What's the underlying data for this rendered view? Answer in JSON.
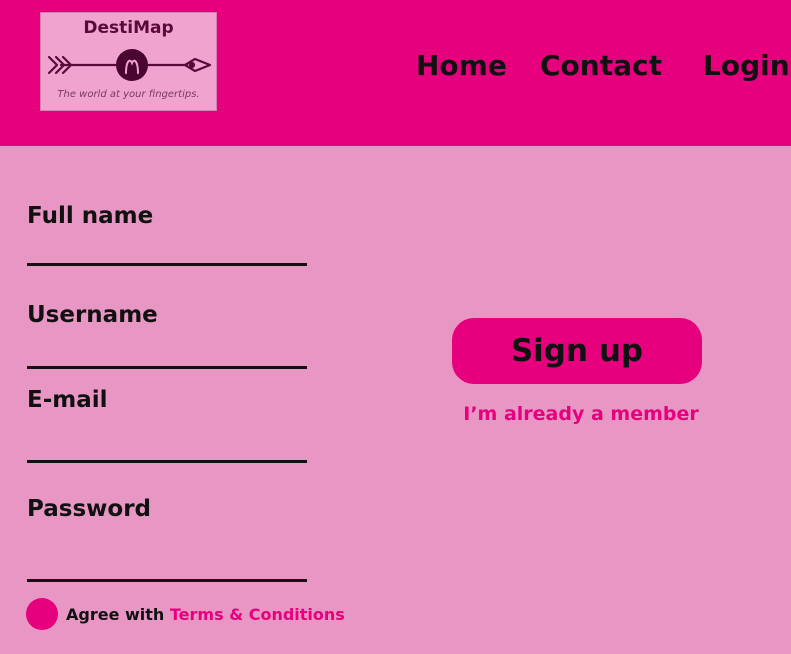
{
  "header": {
    "logo": {
      "title": "DestiMap",
      "tagline": "The world at your fingertips.",
      "icon": "arrow-compass-icon"
    },
    "nav": {
      "home": "Home",
      "contact": "Contact",
      "login": "Login"
    }
  },
  "form": {
    "full_name": {
      "label": "Full name",
      "value": ""
    },
    "username": {
      "label": "Username",
      "value": ""
    },
    "email": {
      "label": "E-mail",
      "value": ""
    },
    "password": {
      "label": "Password",
      "value": ""
    },
    "agree": {
      "prefix": "Agree with",
      "link": "Terms & Conditions"
    }
  },
  "actions": {
    "signup_label": "Sign up",
    "member_link": "I’m already a member"
  },
  "colors": {
    "header_bg": "#e6007e",
    "page_bg": "#e897c4",
    "accent": "#e6007e",
    "logo_bg": "#f0a3cf",
    "text": "#111111"
  }
}
